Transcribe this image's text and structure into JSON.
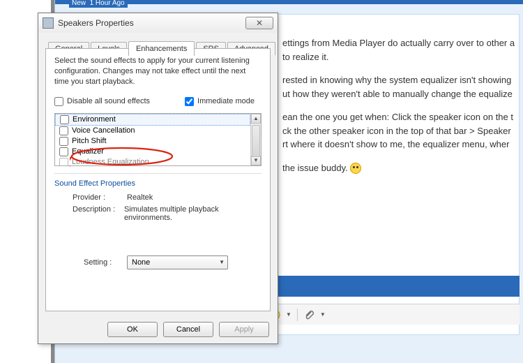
{
  "window": {
    "title": "Speakers Properties",
    "close_label": "✕"
  },
  "tabs": [
    {
      "label": "General"
    },
    {
      "label": "Levels"
    },
    {
      "label": "Enhancements"
    },
    {
      "label": "SRS"
    },
    {
      "label": "Advanced"
    }
  ],
  "enhancements": {
    "instruction": "Select the sound effects to apply for your current listening configuration. Changes may not take effect until the next time you start playback.",
    "disable_label": "Disable all sound effects",
    "disable_checked": false,
    "immediate_label": "Immediate mode",
    "immediate_checked": true,
    "effects": [
      {
        "label": "Environment",
        "checked": false,
        "selected": true
      },
      {
        "label": "Voice Cancellation",
        "checked": false
      },
      {
        "label": "Pitch Shift",
        "checked": false
      },
      {
        "label": "Equalizer",
        "checked": false
      },
      {
        "label": "Loudness Equalization",
        "checked": false
      }
    ],
    "properties_title": "Sound Effect Properties",
    "provider_label": "Provider :",
    "provider_value": "Realtek",
    "description_label": "Description :",
    "description_value": "Simulates multiple playback environments.",
    "setting_label": "Setting :",
    "setting_value": "None"
  },
  "buttons": {
    "ok": "OK",
    "cancel": "Cancel",
    "apply": "Apply"
  },
  "background": {
    "new_label": "New",
    "time_label": "1 Hour Ago",
    "p1": "ettings from Media Player do actually carry over to other a",
    "p1b": "to realize it.",
    "p2": "rested in knowing why the system equalizer isn't showing",
    "p2b": "ut how they weren't able to manually change the equalize",
    "p3": "ean the one you get when: Click the speaker icon on the t",
    "p3b": "ck the other speaker icon in the top of that bar > Speaker",
    "p3c": "rt where it doesn't show to me, the equalizer menu, wher",
    "p4": "the issue buddy. ",
    "toolbar_icons": [
      "table-icon",
      "grid-icon",
      "outdent-icon",
      "indent-icon",
      "image-icon",
      "images-icon",
      "camera-icon",
      "hash-icon",
      "youtube-icon",
      "strike-icon",
      "emoji-icon",
      "attach-icon"
    ]
  }
}
